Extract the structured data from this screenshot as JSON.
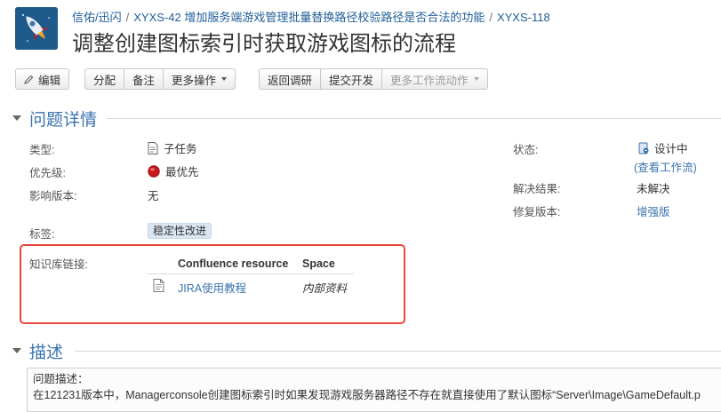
{
  "breadcrumb": {
    "project": "信佑/迅闪",
    "parent": "XYXS-42 增加服务端游戏管理批量替换路径校验路径是否合法的功能",
    "key": "XYXS-118",
    "separator": "/"
  },
  "issue": {
    "title": "调整创建图标索引时获取游戏图标的流程"
  },
  "toolbar": {
    "edit": "编辑",
    "assign": "分配",
    "comment": "备注",
    "more_actions": "更多操作",
    "back_to_research": "返回调研",
    "submit_dev": "提交开发",
    "more_workflow": "更多工作流动作"
  },
  "details": {
    "section_title": "问题详情",
    "type_label": "类型:",
    "type_value": "子任务",
    "priority_label": "优先级:",
    "priority_value": "最优先",
    "affects_label": "影响版本:",
    "affects_value": "无",
    "labels_label": "标签:",
    "label_tag": "稳定性改进",
    "status_label": "状态:",
    "status_value": "设计中",
    "view_workflow": "(查看工作流)",
    "resolution_label": "解决结果:",
    "resolution_value": "未解决",
    "fix_version_label": "修复版本:",
    "fix_version_value": "增强版"
  },
  "knowledge": {
    "label": "知识库链接:",
    "col_resource": "Confluence resource",
    "col_space": "Space",
    "rows": [
      {
        "resource": "JIRA使用教程",
        "space": "内部资料"
      }
    ]
  },
  "description": {
    "section_title": "描述",
    "line1": "问题描述：",
    "line2": "在121231版本中，Managerconsole创建图标索引时如果发现游戏服务器路径不存在就直接使用了默认图标“Server\\Image\\GameDefault.p"
  },
  "colors": {
    "link": "#3b73af",
    "highlight_border": "#e8473a",
    "priority_red": "#c8171d",
    "tag_bg": "#dbe6f2"
  },
  "icons": {
    "logo": "rocket-logo-icon",
    "edit": "pencil-icon",
    "type": "subtask-document-icon",
    "priority": "priority-blocker-icon",
    "status": "status-design-icon",
    "resource": "page-document-icon",
    "twixie": "caret-down-icon"
  }
}
